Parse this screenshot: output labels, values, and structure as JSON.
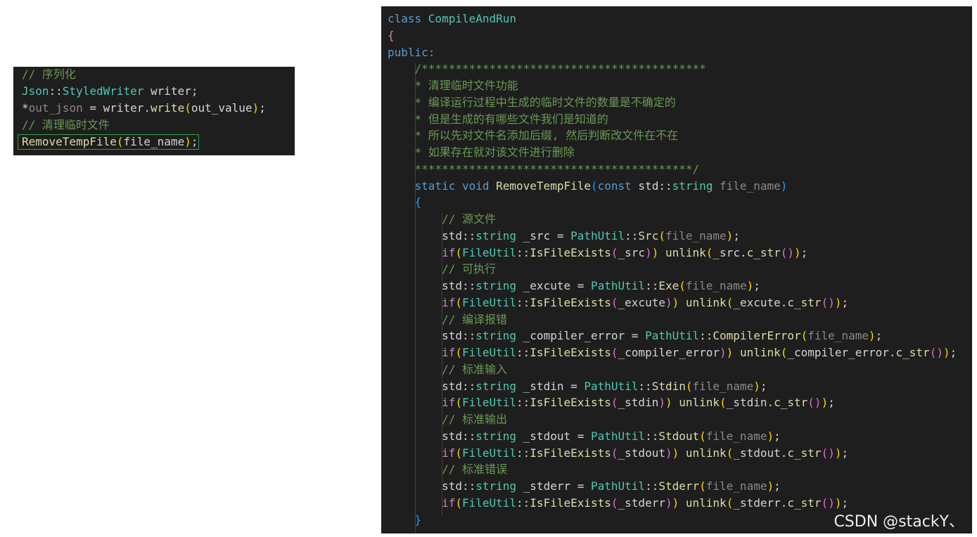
{
  "watermark": "CSDN @stackY、",
  "colors": {
    "background": "#1e1e1e",
    "keyword": "#569cd6",
    "type": "#4ec9b0",
    "function": "#dcdcaa",
    "comment": "#6a9955",
    "bracket_1": "#ffd700",
    "bracket_2": "#da70d6",
    "bracket_3": "#179fff",
    "highlight_border": "#2ea043"
  },
  "left_panel": {
    "lines": [
      [
        [
          "t-comment",
          "// 序列化"
        ]
      ],
      [
        [
          "t-type",
          "Json"
        ],
        [
          "t-plain",
          "::"
        ],
        [
          "t-type",
          "StyledWriter"
        ],
        [
          "t-plain",
          " writer;"
        ]
      ],
      [
        [
          "t-plain",
          "*"
        ],
        [
          "t-dim",
          "out_json"
        ],
        [
          "t-plain",
          " = writer."
        ],
        [
          "t-fn",
          "write"
        ],
        [
          "t-paren",
          "("
        ],
        [
          "t-plain",
          "out_value"
        ],
        [
          "t-paren",
          ")"
        ],
        [
          "t-plain",
          ";"
        ]
      ],
      [
        [
          "t-comment",
          "// 清理临时文件"
        ]
      ],
      [
        [
          "t-fn",
          "RemoveTempFile"
        ],
        [
          "t-paren",
          "("
        ],
        [
          "t-plain",
          "file_name"
        ],
        [
          "t-paren",
          ")"
        ],
        [
          "t-plain",
          ";"
        ]
      ]
    ]
  },
  "right_panel": {
    "lines": [
      [
        [
          "t-kw",
          "class "
        ],
        [
          "t-type",
          "CompileAndRun"
        ]
      ],
      [
        [
          "t-purple",
          "{"
        ]
      ],
      [
        [
          "t-kw",
          "public:"
        ]
      ],
      [
        [
          "t-plain",
          "    "
        ],
        [
          "t-comment",
          "/******************************************"
        ]
      ],
      [
        [
          "t-plain",
          "    "
        ],
        [
          "t-comment",
          "* 清理临时文件功能"
        ]
      ],
      [
        [
          "t-plain",
          "    "
        ],
        [
          "t-comment",
          "* 编译运行过程中生成的临时文件的数量是不确定的"
        ]
      ],
      [
        [
          "t-plain",
          "    "
        ],
        [
          "t-comment",
          "* 但是生成的有哪些文件我们是知道的"
        ]
      ],
      [
        [
          "t-plain",
          "    "
        ],
        [
          "t-comment",
          "* 所以先对文件名添加后缀, 然后判断改文件在不在"
        ]
      ],
      [
        [
          "t-plain",
          "    "
        ],
        [
          "t-comment",
          "* 如果存在就对该文件进行删除"
        ]
      ],
      [
        [
          "t-plain",
          "    "
        ],
        [
          "t-comment",
          "*****************************************/"
        ]
      ],
      [
        [
          "t-plain",
          "    "
        ],
        [
          "t-kw",
          "static void "
        ],
        [
          "t-fn",
          "RemoveTempFile"
        ],
        [
          "t-paren3",
          "("
        ],
        [
          "t-kw",
          "const "
        ],
        [
          "t-plain",
          "std::"
        ],
        [
          "t-type",
          "string "
        ],
        [
          "t-dim",
          "file_name"
        ],
        [
          "t-paren3",
          ")"
        ]
      ],
      [
        [
          "t-plain",
          "    "
        ],
        [
          "t-paren3",
          "{"
        ]
      ],
      [
        [
          "t-plain",
          "        "
        ],
        [
          "t-comment",
          "// 源文件"
        ]
      ],
      [
        [
          "t-plain",
          "        std::"
        ],
        [
          "t-type",
          "string"
        ],
        [
          "t-plain",
          " _src = "
        ],
        [
          "t-type",
          "PathUtil"
        ],
        [
          "t-plain",
          "::"
        ],
        [
          "t-fn",
          "Src"
        ],
        [
          "t-paren",
          "("
        ],
        [
          "t-dim",
          "file_name"
        ],
        [
          "t-paren",
          ")"
        ],
        [
          "t-plain",
          ";"
        ]
      ],
      [
        [
          "t-plain",
          "        "
        ],
        [
          "t-ctrl",
          "if"
        ],
        [
          "t-paren",
          "("
        ],
        [
          "t-type",
          "FileUtil"
        ],
        [
          "t-plain",
          "::"
        ],
        [
          "t-fn",
          "IsFileExists"
        ],
        [
          "t-paren2",
          "("
        ],
        [
          "t-plain",
          "_src"
        ],
        [
          "t-paren2",
          ")"
        ],
        [
          "t-paren",
          ")"
        ],
        [
          "t-plain",
          " "
        ],
        [
          "t-fn",
          "unlink"
        ],
        [
          "t-paren",
          "("
        ],
        [
          "t-plain",
          "_src."
        ],
        [
          "t-fn",
          "c_str"
        ],
        [
          "t-paren2",
          "()"
        ],
        [
          "t-paren",
          ")"
        ],
        [
          "t-plain",
          ";"
        ]
      ],
      [
        [
          "t-plain",
          "        "
        ],
        [
          "t-comment",
          "// 可执行"
        ]
      ],
      [
        [
          "t-plain",
          "        std::"
        ],
        [
          "t-type",
          "string"
        ],
        [
          "t-plain",
          " _excute = "
        ],
        [
          "t-type",
          "PathUtil"
        ],
        [
          "t-plain",
          "::"
        ],
        [
          "t-fn",
          "Exe"
        ],
        [
          "t-paren",
          "("
        ],
        [
          "t-dim",
          "file_name"
        ],
        [
          "t-paren",
          ")"
        ],
        [
          "t-plain",
          ";"
        ]
      ],
      [
        [
          "t-plain",
          "        "
        ],
        [
          "t-ctrl",
          "if"
        ],
        [
          "t-paren",
          "("
        ],
        [
          "t-type",
          "FileUtil"
        ],
        [
          "t-plain",
          "::"
        ],
        [
          "t-fn",
          "IsFileExists"
        ],
        [
          "t-paren2",
          "("
        ],
        [
          "t-plain",
          "_excute"
        ],
        [
          "t-paren2",
          ")"
        ],
        [
          "t-paren",
          ")"
        ],
        [
          "t-plain",
          " "
        ],
        [
          "t-fn",
          "unlink"
        ],
        [
          "t-paren",
          "("
        ],
        [
          "t-plain",
          "_excute."
        ],
        [
          "t-fn",
          "c_str"
        ],
        [
          "t-paren2",
          "()"
        ],
        [
          "t-paren",
          ")"
        ],
        [
          "t-plain",
          ";"
        ]
      ],
      [
        [
          "t-plain",
          "        "
        ],
        [
          "t-comment",
          "// 编译报错"
        ]
      ],
      [
        [
          "t-plain",
          "        std::"
        ],
        [
          "t-type",
          "string"
        ],
        [
          "t-plain",
          " _compiler_error = "
        ],
        [
          "t-type",
          "PathUtil"
        ],
        [
          "t-plain",
          "::"
        ],
        [
          "t-fn",
          "CompilerError"
        ],
        [
          "t-paren",
          "("
        ],
        [
          "t-dim",
          "file_name"
        ],
        [
          "t-paren",
          ")"
        ],
        [
          "t-plain",
          ";"
        ]
      ],
      [
        [
          "t-plain",
          "        "
        ],
        [
          "t-ctrl",
          "if"
        ],
        [
          "t-paren",
          "("
        ],
        [
          "t-type",
          "FileUtil"
        ],
        [
          "t-plain",
          "::"
        ],
        [
          "t-fn",
          "IsFileExists"
        ],
        [
          "t-paren2",
          "("
        ],
        [
          "t-plain",
          "_compiler_error"
        ],
        [
          "t-paren2",
          ")"
        ],
        [
          "t-paren",
          ")"
        ],
        [
          "t-plain",
          " "
        ],
        [
          "t-fn",
          "unlink"
        ],
        [
          "t-paren",
          "("
        ],
        [
          "t-plain",
          "_compiler_error."
        ],
        [
          "t-fn",
          "c_str"
        ],
        [
          "t-paren2",
          "()"
        ],
        [
          "t-paren",
          ")"
        ],
        [
          "t-plain",
          ";"
        ]
      ],
      [
        [
          "t-plain",
          "        "
        ],
        [
          "t-comment",
          "// 标准输入"
        ]
      ],
      [
        [
          "t-plain",
          "        std::"
        ],
        [
          "t-type",
          "string"
        ],
        [
          "t-plain",
          " _stdin = "
        ],
        [
          "t-type",
          "PathUtil"
        ],
        [
          "t-plain",
          "::"
        ],
        [
          "t-fn",
          "Stdin"
        ],
        [
          "t-paren",
          "("
        ],
        [
          "t-dim",
          "file_name"
        ],
        [
          "t-paren",
          ")"
        ],
        [
          "t-plain",
          ";"
        ]
      ],
      [
        [
          "t-plain",
          "        "
        ],
        [
          "t-ctrl",
          "if"
        ],
        [
          "t-paren",
          "("
        ],
        [
          "t-type",
          "FileUtil"
        ],
        [
          "t-plain",
          "::"
        ],
        [
          "t-fn",
          "IsFileExists"
        ],
        [
          "t-paren2",
          "("
        ],
        [
          "t-plain",
          "_stdin"
        ],
        [
          "t-paren2",
          ")"
        ],
        [
          "t-paren",
          ")"
        ],
        [
          "t-plain",
          " "
        ],
        [
          "t-fn",
          "unlink"
        ],
        [
          "t-paren",
          "("
        ],
        [
          "t-plain",
          "_stdin."
        ],
        [
          "t-fn",
          "c_str"
        ],
        [
          "t-paren2",
          "()"
        ],
        [
          "t-paren",
          ")"
        ],
        [
          "t-plain",
          ";"
        ]
      ],
      [
        [
          "t-plain",
          "        "
        ],
        [
          "t-comment",
          "// 标准输出"
        ]
      ],
      [
        [
          "t-plain",
          "        std::"
        ],
        [
          "t-type",
          "string"
        ],
        [
          "t-plain",
          " _stdout = "
        ],
        [
          "t-type",
          "PathUtil"
        ],
        [
          "t-plain",
          "::"
        ],
        [
          "t-fn",
          "Stdout"
        ],
        [
          "t-paren",
          "("
        ],
        [
          "t-dim",
          "file_name"
        ],
        [
          "t-paren",
          ")"
        ],
        [
          "t-plain",
          ";"
        ]
      ],
      [
        [
          "t-plain",
          "        "
        ],
        [
          "t-ctrl",
          "if"
        ],
        [
          "t-paren",
          "("
        ],
        [
          "t-type",
          "FileUtil"
        ],
        [
          "t-plain",
          "::"
        ],
        [
          "t-fn",
          "IsFileExists"
        ],
        [
          "t-paren2",
          "("
        ],
        [
          "t-plain",
          "_stdout"
        ],
        [
          "t-paren2",
          ")"
        ],
        [
          "t-paren",
          ")"
        ],
        [
          "t-plain",
          " "
        ],
        [
          "t-fn",
          "unlink"
        ],
        [
          "t-paren",
          "("
        ],
        [
          "t-plain",
          "_stdout."
        ],
        [
          "t-fn",
          "c_str"
        ],
        [
          "t-paren2",
          "()"
        ],
        [
          "t-paren",
          ")"
        ],
        [
          "t-plain",
          ";"
        ]
      ],
      [
        [
          "t-plain",
          "        "
        ],
        [
          "t-comment",
          "// 标准错误"
        ]
      ],
      [
        [
          "t-plain",
          "        std::"
        ],
        [
          "t-type",
          "string"
        ],
        [
          "t-plain",
          " _stderr = "
        ],
        [
          "t-type",
          "PathUtil"
        ],
        [
          "t-plain",
          "::"
        ],
        [
          "t-fn",
          "Stderr"
        ],
        [
          "t-paren",
          "("
        ],
        [
          "t-dim",
          "file_name"
        ],
        [
          "t-paren",
          ")"
        ],
        [
          "t-plain",
          ";"
        ]
      ],
      [
        [
          "t-plain",
          "        "
        ],
        [
          "t-ctrl",
          "if"
        ],
        [
          "t-paren",
          "("
        ],
        [
          "t-type",
          "FileUtil"
        ],
        [
          "t-plain",
          "::"
        ],
        [
          "t-fn",
          "IsFileExists"
        ],
        [
          "t-paren2",
          "("
        ],
        [
          "t-plain",
          "_stderr"
        ],
        [
          "t-paren2",
          ")"
        ],
        [
          "t-paren",
          ")"
        ],
        [
          "t-plain",
          " "
        ],
        [
          "t-fn",
          "unlink"
        ],
        [
          "t-paren",
          "("
        ],
        [
          "t-plain",
          "_stderr."
        ],
        [
          "t-fn",
          "c_str"
        ],
        [
          "t-paren2",
          "()"
        ],
        [
          "t-paren",
          ")"
        ],
        [
          "t-plain",
          ";"
        ]
      ],
      [
        [
          "t-plain",
          "    "
        ],
        [
          "t-paren3",
          "}"
        ]
      ]
    ]
  }
}
